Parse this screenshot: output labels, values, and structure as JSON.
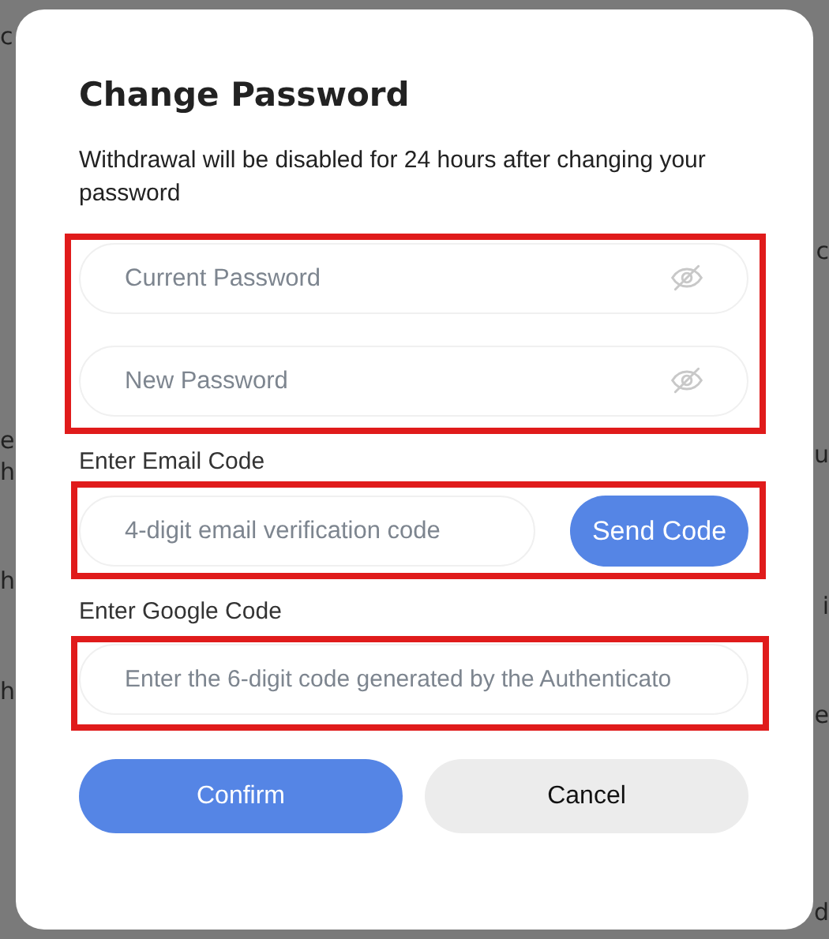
{
  "background_left_edge": [
    "c",
    "e",
    "h",
    "h",
    "h"
  ],
  "background_right_edge": [
    "c",
    "u",
    "i",
    "e",
    "d"
  ],
  "dialog": {
    "title": "Change Password",
    "notice": "Withdrawal will be disabled for 24 hours after changing your password",
    "password_fields": [
      {
        "placeholder": "Current Password",
        "kind": "password"
      },
      {
        "placeholder": "New Password",
        "kind": "password"
      }
    ],
    "email_code": {
      "label": "Enter Email Code",
      "placeholder": "4-digit email verification code",
      "button": "Send Code"
    },
    "google_code": {
      "label": "Enter Google Code",
      "placeholder": "Enter the 6-digit code generated by the Authenticato"
    },
    "buttons": [
      {
        "label": "Confirm",
        "kind": "primary"
      },
      {
        "label": "Cancel",
        "kind": "secondary"
      }
    ]
  }
}
